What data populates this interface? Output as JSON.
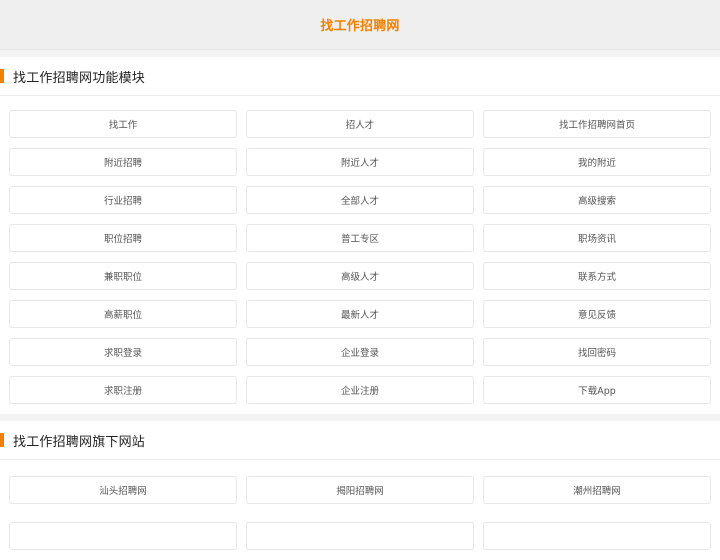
{
  "header": {
    "title": "找工作招聘网"
  },
  "colors": {
    "accent": "#f08200",
    "page_bg": "#efefef"
  },
  "section_functions": {
    "title": "找工作招聘网功能模块",
    "items": [
      "找工作",
      "招人才",
      "找工作招聘网首页",
      "附近招聘",
      "附近人才",
      "我的附近",
      "行业招聘",
      "全部人才",
      "高级搜索",
      "职位招聘",
      "普工专区",
      "职场资讯",
      "兼职职位",
      "高级人才",
      "联系方式",
      "高薪职位",
      "最新人才",
      "意见反馈",
      "求职登录",
      "企业登录",
      "找回密码",
      "求职注册",
      "企业注册",
      "下载App"
    ]
  },
  "section_sites": {
    "title": "找工作招聘网旗下网站",
    "items": [
      "汕头招聘网",
      "揭阳招聘网",
      "潮州招聘网",
      "",
      "",
      ""
    ]
  }
}
